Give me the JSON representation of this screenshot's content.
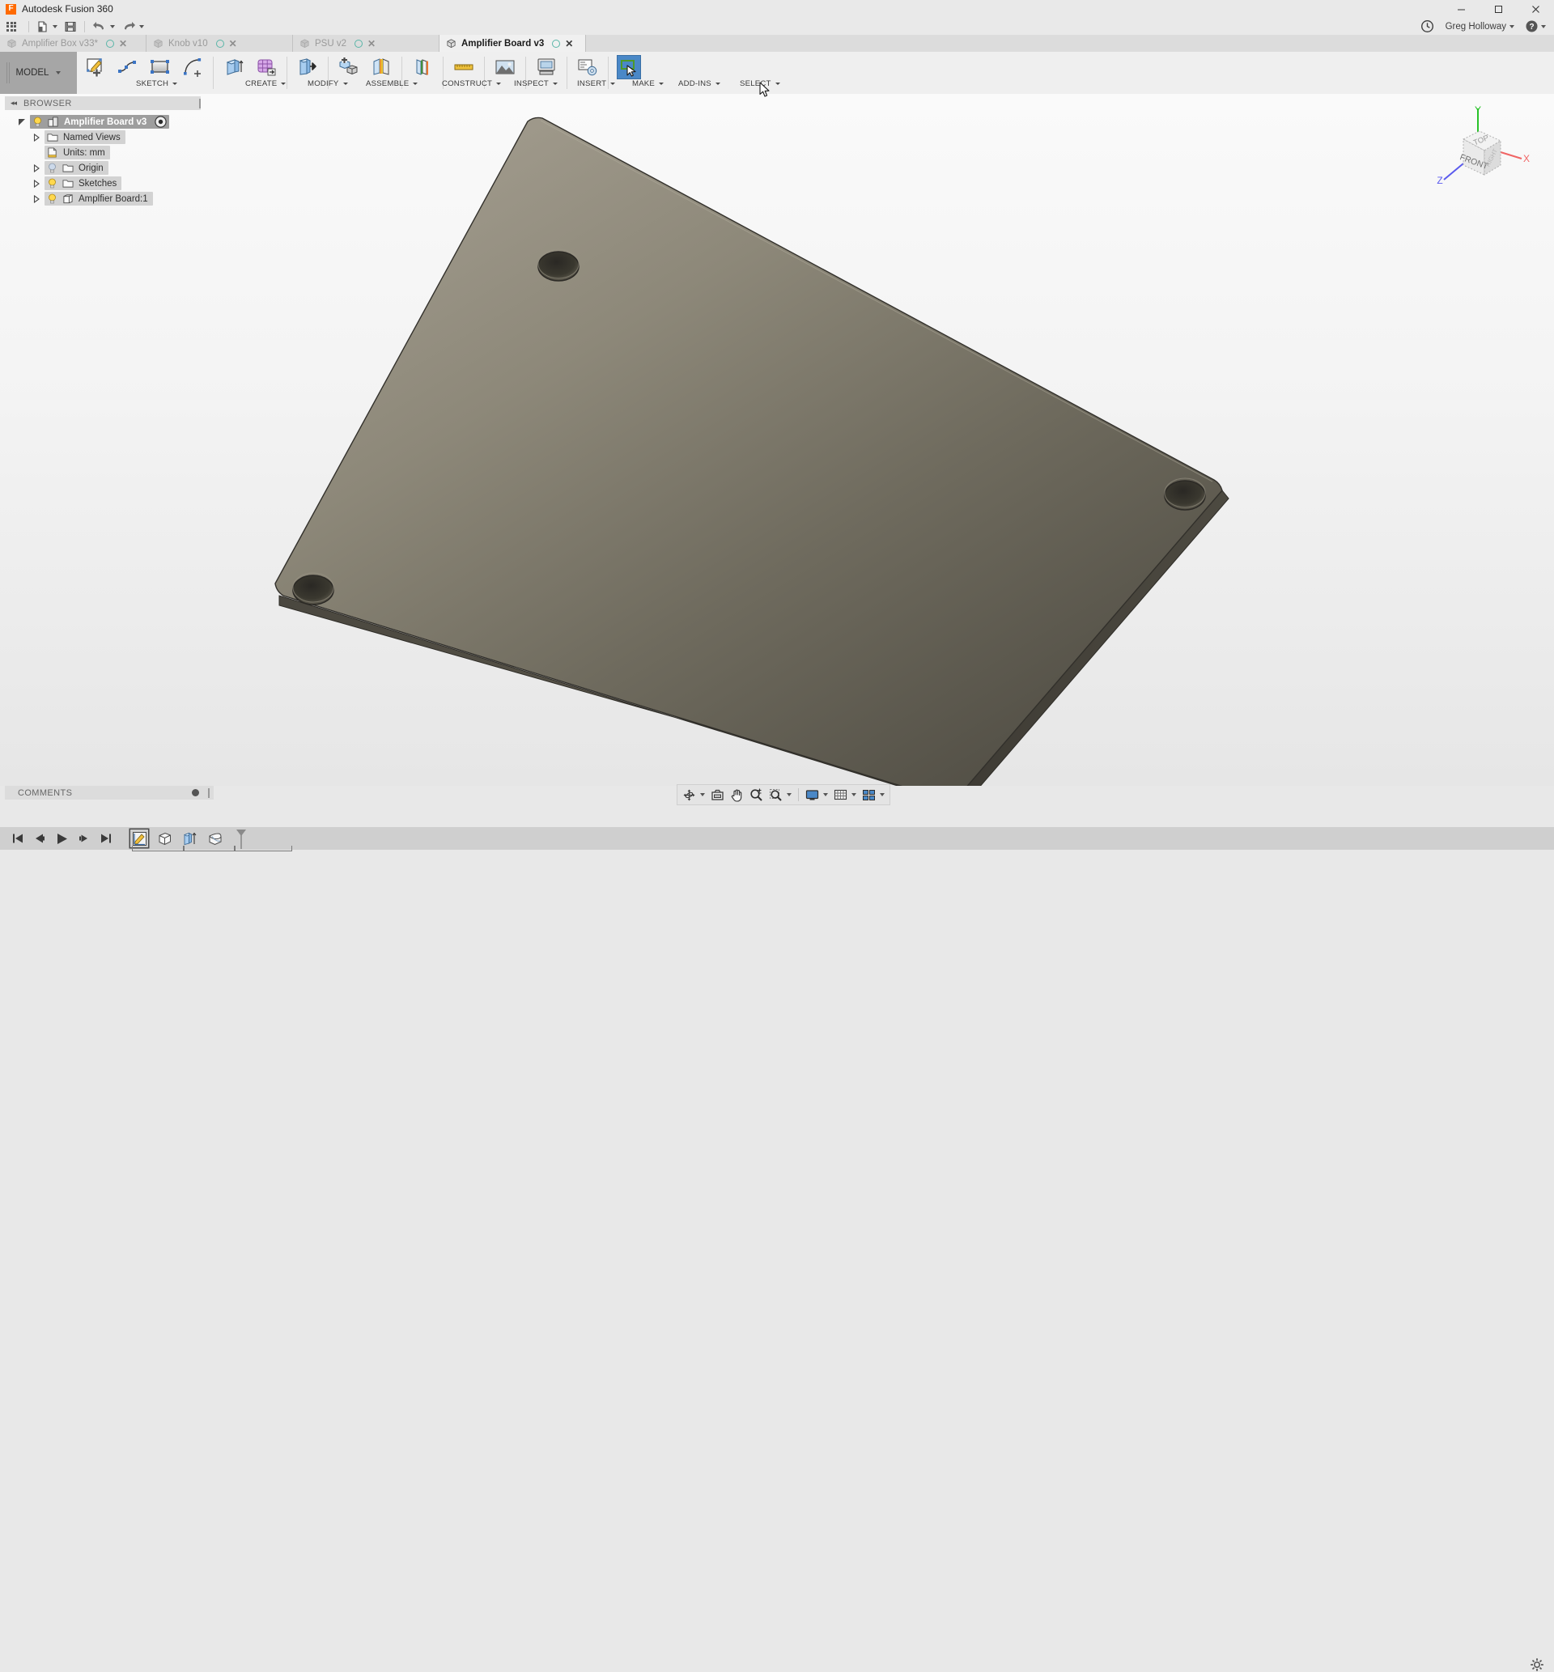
{
  "window": {
    "title": "Autodesk Fusion 360",
    "logo_text": "F",
    "controls": {
      "minimize": "minimize-icon",
      "maximize": "maximize-icon",
      "close": "close-icon"
    }
  },
  "quick_access": {
    "items": [
      {
        "name": "app-grid",
        "icon": "grid-icon",
        "has_caret": false
      },
      {
        "name": "new-document",
        "icon": "file-icon",
        "has_caret": true
      },
      {
        "name": "save",
        "icon": "save-icon",
        "has_caret": false
      },
      {
        "name": "undo",
        "icon": "undo-arrow-icon",
        "has_caret": true
      },
      {
        "name": "redo",
        "icon": "redo-arrow-icon",
        "has_caret": true
      }
    ]
  },
  "account": {
    "recent_label": "clock-icon",
    "user_name": "Greg Holloway",
    "help_label": "help-icon"
  },
  "document_tabs": [
    {
      "label": "Amplifier Box v33*",
      "active": false
    },
    {
      "label": "Knob v10",
      "active": false
    },
    {
      "label": "PSU v2",
      "active": false
    },
    {
      "label": "Amplifier Board v3",
      "active": true
    }
  ],
  "ribbon": {
    "workspace": "MODEL",
    "groups": [
      {
        "label": "SKETCH",
        "tools": [
          "create-sketch-icon",
          "spline-icon",
          "rectangle-icon",
          "arc-icon"
        ]
      },
      {
        "label": "CREATE",
        "tools": [
          "extrude-icon",
          "mesh-icon"
        ]
      },
      {
        "label": "MODIFY",
        "tools": [
          "press-pull-icon"
        ]
      },
      {
        "label": "ASSEMBLE",
        "tools": [
          "new-component-icon",
          "joint-icon"
        ]
      },
      {
        "label": "CONSTRUCT",
        "tools": [
          "offset-plane-icon"
        ]
      },
      {
        "label": "INSPECT",
        "tools": [
          "measure-icon"
        ]
      },
      {
        "label": "INSERT",
        "tools": [
          "insert-image-icon"
        ]
      },
      {
        "label": "MAKE",
        "tools": [
          "3d-print-icon"
        ]
      },
      {
        "label": "ADD-INS",
        "tools": [
          "scripts-addins-icon"
        ]
      },
      {
        "label": "SELECT",
        "tools": [
          "select-icon"
        ],
        "selected": true
      }
    ]
  },
  "browser": {
    "header": "BROWSER",
    "collapse_icon": "collapse-left-icon",
    "tree": [
      {
        "label": "Amplifier Board v3",
        "indent": 0,
        "twisty": "expanded",
        "bulb": "on",
        "icon": "component-icon",
        "root": true,
        "eye": "visibility-toggle"
      },
      {
        "label": "Named Views",
        "indent": 1,
        "twisty": "collapsed",
        "bulb": "none",
        "icon": "folder-icon"
      },
      {
        "label": "Units: mm",
        "indent": 1,
        "twisty": "none",
        "bulb": "none",
        "icon": "document-units-icon"
      },
      {
        "label": "Origin",
        "indent": 1,
        "twisty": "collapsed",
        "bulb": "off",
        "icon": "folder-icon"
      },
      {
        "label": "Sketches",
        "indent": 1,
        "twisty": "collapsed",
        "bulb": "on",
        "icon": "folder-icon"
      },
      {
        "label": "Amplfier Board:1",
        "indent": 1,
        "twisty": "collapsed",
        "bulb": "on",
        "icon": "body-icon"
      }
    ]
  },
  "view_cube": {
    "faces": {
      "top": "TOP",
      "front": "FRONT",
      "right": "RIGHT"
    },
    "axes": [
      {
        "label": "Y",
        "color": "#29c229"
      },
      {
        "label": "X",
        "color": "#f06464"
      },
      {
        "label": "Z",
        "color": "#5a5aee"
      }
    ]
  },
  "canvas": {
    "model_name": "Amplifier Board",
    "description": "Rectangular flat plate with four corner mounting holes, shaded olive-grey",
    "colors": {
      "top_face_light": "#8c887c",
      "top_face_dark": "#555148",
      "side_face": "#4e4b43",
      "edge": "#33312c",
      "hole": "#2f2d29"
    }
  },
  "comments_panel": {
    "header": "COMMENTS"
  },
  "nav_bar": {
    "items": [
      {
        "name": "orbit-icon",
        "caret": true
      },
      {
        "name": "look-at-icon",
        "caret": false
      },
      {
        "name": "pan-hand-icon",
        "caret": false
      },
      {
        "name": "zoom-icon",
        "caret": false
      },
      {
        "name": "zoom-window-icon",
        "caret": true
      },
      {
        "name": "display-settings-icon",
        "caret": true
      },
      {
        "name": "grid-snap-icon",
        "caret": true
      },
      {
        "name": "viewports-icon",
        "caret": true
      }
    ]
  },
  "timeline": {
    "transport": [
      "go-to-beginning-icon",
      "step-back-icon",
      "play-icon",
      "step-forward-icon",
      "go-to-end-icon"
    ],
    "features": [
      {
        "name": "sketch-feature-icon",
        "selected": true
      },
      {
        "name": "extrude-feature-icon",
        "selected": false
      },
      {
        "name": "extrude2-feature-icon",
        "selected": false
      },
      {
        "name": "fillet-feature-icon",
        "selected": false
      }
    ],
    "end_marker": "timeline-marker-icon",
    "settings": "settings-gear-icon"
  }
}
